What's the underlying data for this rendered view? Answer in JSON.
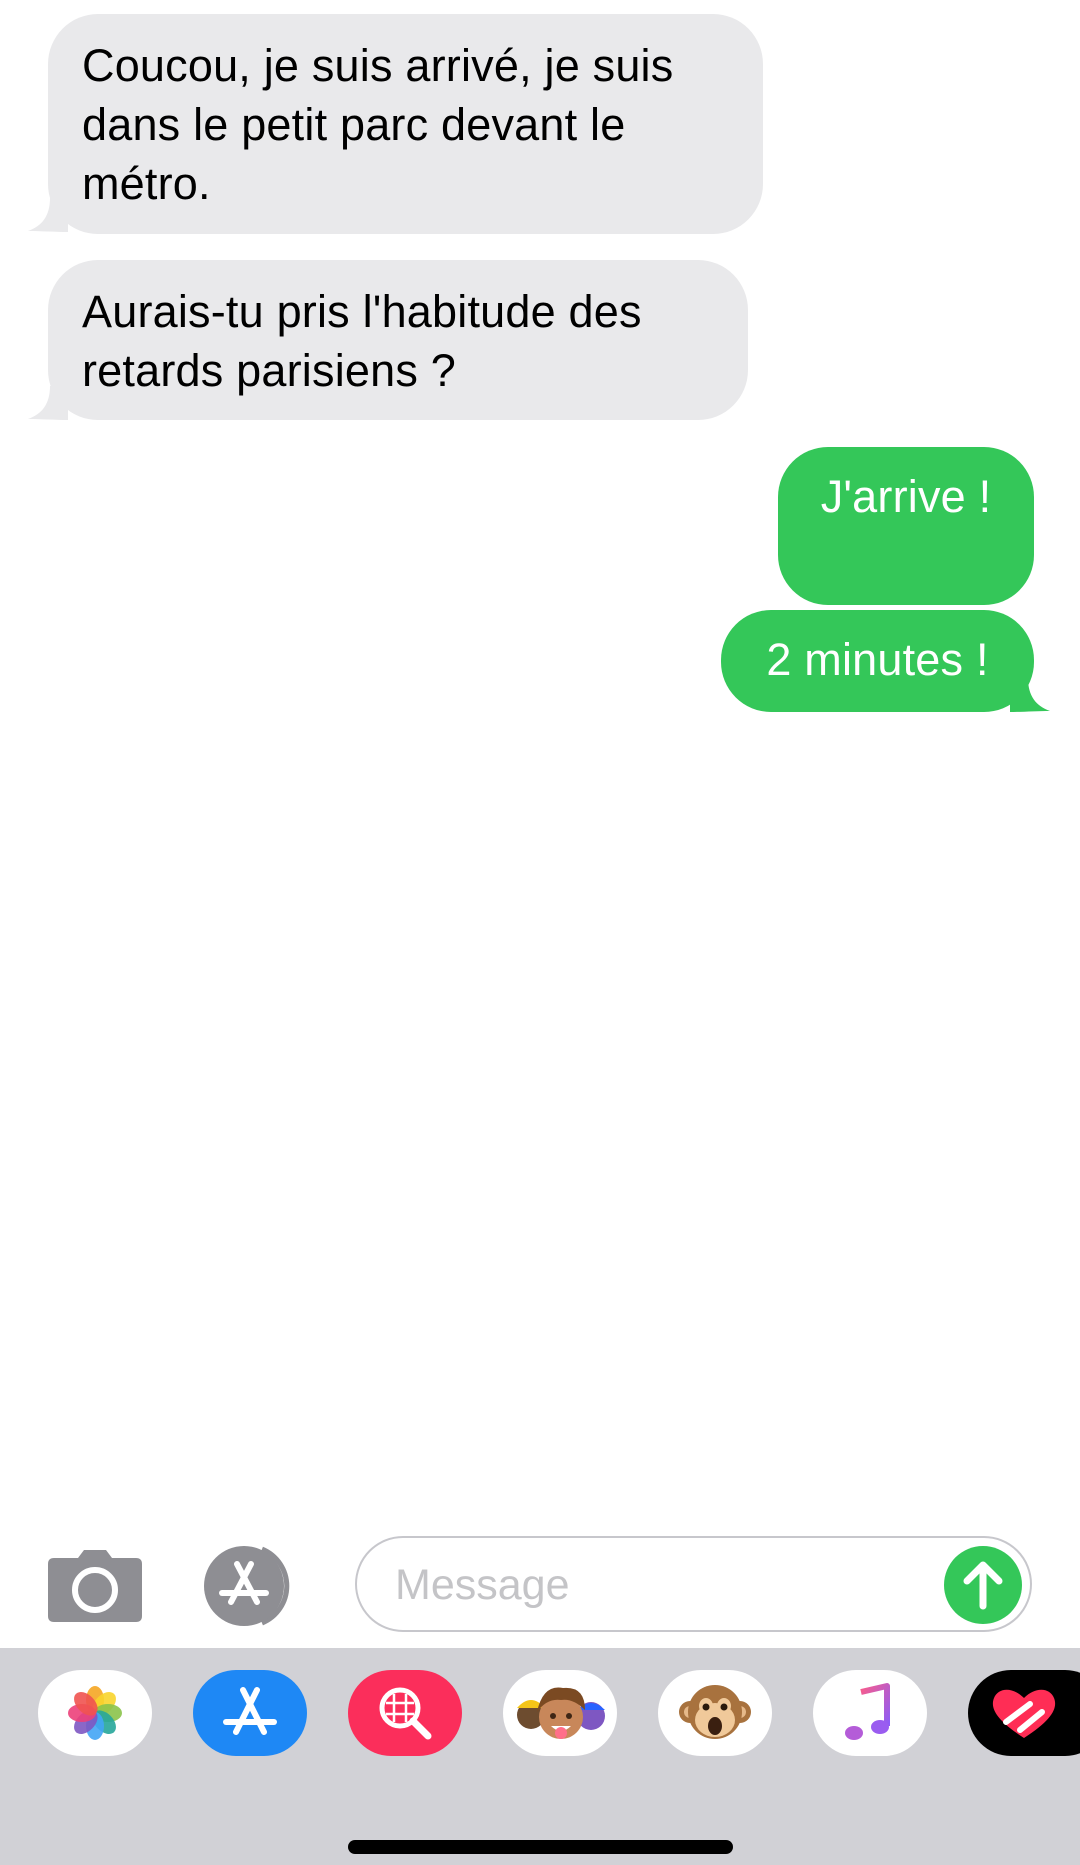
{
  "conversation": {
    "messages": [
      {
        "direction": "incoming",
        "text": "Coucou, je suis arrivé, je suis dans le petit parc devant le métro."
      },
      {
        "direction": "incoming",
        "text": "Aurais-tu pris l'habitude des retards parisiens ?"
      },
      {
        "direction": "outgoing",
        "text": "J'arrive !"
      },
      {
        "direction": "outgoing",
        "text": "2 minutes !"
      }
    ]
  },
  "compose": {
    "placeholder": "Message",
    "value": "",
    "camera_icon": "camera-icon",
    "apps_icon": "app-store-icon",
    "send_icon": "arrow-up-icon"
  },
  "app_drawer": {
    "apps": [
      {
        "icon": "photos-icon"
      },
      {
        "icon": "app-store-icon"
      },
      {
        "icon": "images-search-icon"
      },
      {
        "icon": "memoji-stickers-icon"
      },
      {
        "icon": "animoji-monkey-icon"
      },
      {
        "icon": "music-icon"
      },
      {
        "icon": "digital-touch-heart-icon"
      }
    ]
  },
  "colors": {
    "incoming_bubble": "#e9e9eb",
    "outgoing_bubble": "#34c759",
    "drawer_background": "#d1d1d6"
  }
}
